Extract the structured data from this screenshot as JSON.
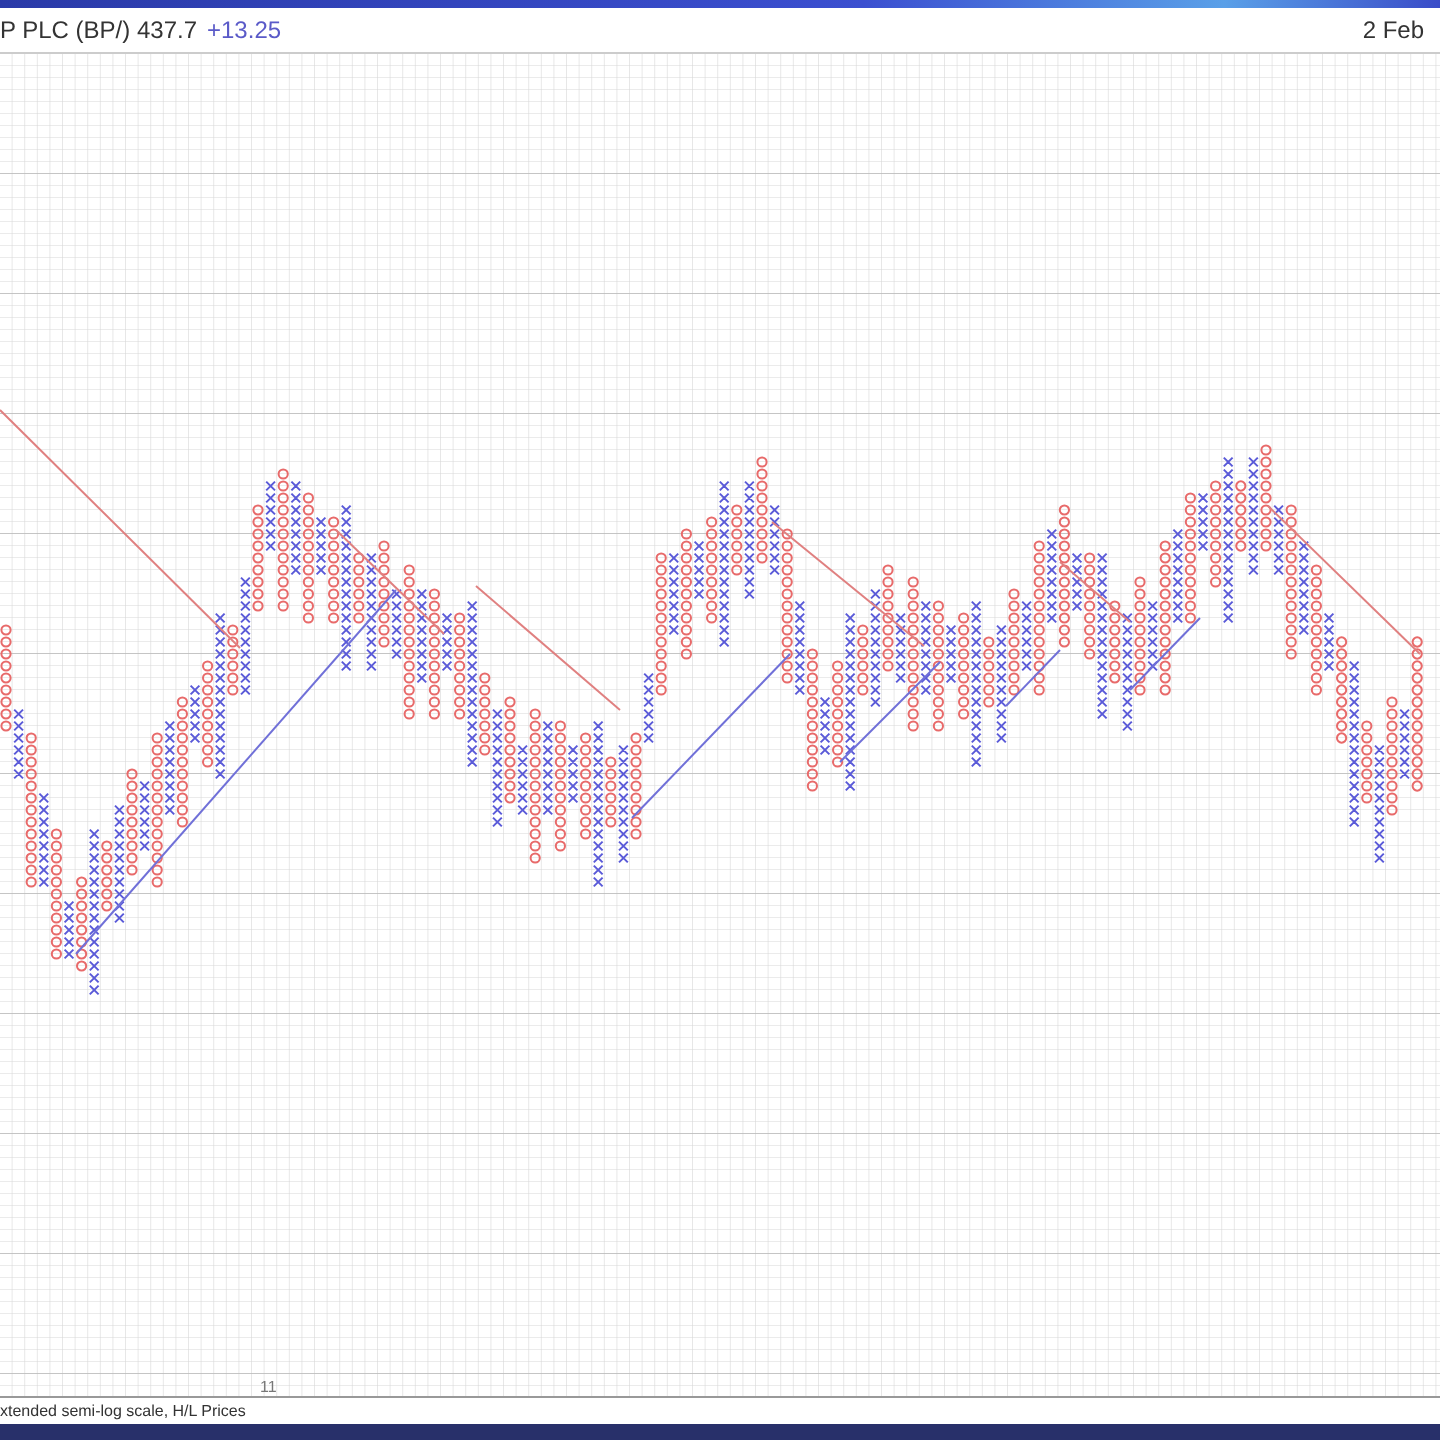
{
  "header": {
    "title": "P PLC (BP/) 437.7",
    "change": "+13.25",
    "date": "2 Feb"
  },
  "chart": {
    "axis_label": "11"
  },
  "footer": {
    "scale_note": "xtended semi-log scale, H/L Prices"
  }
}
